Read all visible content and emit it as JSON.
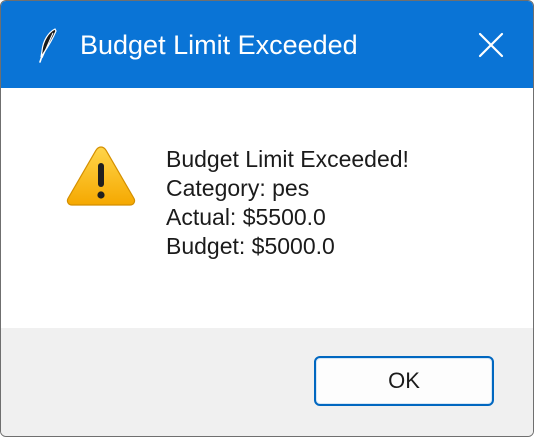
{
  "window": {
    "title": "Budget Limit Exceeded",
    "title_icon": "feather-icon",
    "close_icon": "close-icon",
    "titlebar_color": "#0a74d6"
  },
  "message": {
    "icon": "warning-icon",
    "lines": [
      "Budget Limit Exceeded!",
      "Category: pes",
      "Actual: $5500.0",
      "Budget: $5000.0"
    ]
  },
  "buttons": {
    "ok_label": "OK",
    "accent_color": "#0067c0"
  }
}
